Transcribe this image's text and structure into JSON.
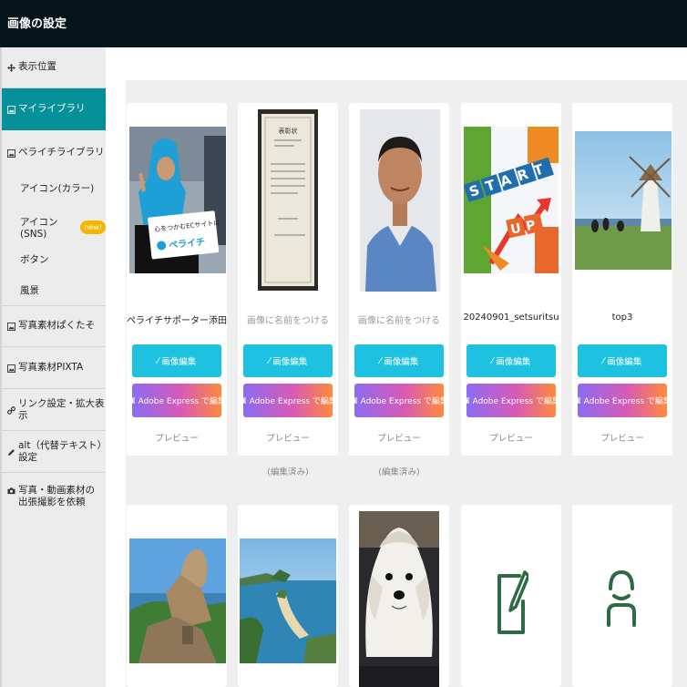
{
  "header": {
    "title": "画像の設定"
  },
  "sidebar": {
    "items": [
      {
        "label": "表示位置",
        "icon": "move-icon"
      },
      {
        "label": "マイライブラリ",
        "icon": "image-icon",
        "active": true
      },
      {
        "label": "ペライチライブラリ",
        "icon": "image-icon"
      },
      {
        "label": "写真素材ぱくたそ",
        "icon": "image-icon"
      },
      {
        "label": "写真素材PIXTA",
        "icon": "image-icon"
      },
      {
        "label": "リンク設定・拡大表示",
        "icon": "link-icon"
      },
      {
        "label": "alt（代替テキスト）設定",
        "icon": "pen-icon"
      },
      {
        "label_line1": "写真・動画素材の",
        "label_line2": "出張撮影を依頼",
        "icon": "camera-icon"
      }
    ],
    "sub_items": [
      "アイコン(カラー)",
      "アイコン(SNS)",
      "ボタン",
      "風景"
    ],
    "new_badge": "new!"
  },
  "buttons": {
    "edit_label": "画像編集",
    "adobe_label": "Adobe Express で編集",
    "preview_label": "プレビュー",
    "edited_label": "(編集済み)"
  },
  "cards": [
    {
      "caption": "ペライチサポーター添田",
      "placeholder": false
    },
    {
      "caption": "画像に名前をつける",
      "placeholder": true
    },
    {
      "caption": "画像に名前をつける",
      "placeholder": true
    },
    {
      "caption": "20240901_setsuritsu",
      "placeholder": false
    },
    {
      "caption": "top3",
      "placeholder": false
    }
  ],
  "image_text": {
    "sign_line1": "心をつかむECサイトは",
    "sign_line2": "ペライチ",
    "start": "START",
    "up": "UP",
    "certificate_title": "表彰状"
  },
  "colors": {
    "header_bg": "#06141b",
    "active_bg": "#069099",
    "edit_button": "#1ec2e0",
    "badge": "#f7b500",
    "icon_green": "#2e6b45"
  }
}
